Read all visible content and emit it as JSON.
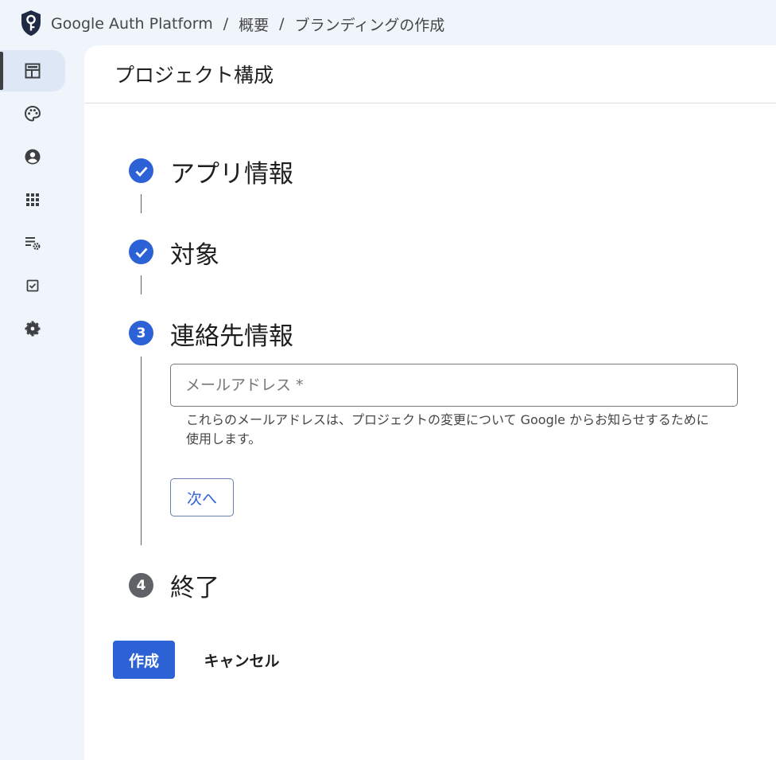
{
  "breadcrumb": {
    "app_name": "Google Auth Platform",
    "separator": "/",
    "items": [
      "概要",
      "ブランディングの作成"
    ]
  },
  "rail": {
    "items": [
      {
        "icon": "dashboard-icon",
        "active": true
      },
      {
        "icon": "palette-icon",
        "active": false
      },
      {
        "icon": "account-circle-icon",
        "active": false
      },
      {
        "icon": "apps-grid-icon",
        "active": false
      },
      {
        "icon": "list-settings-icon",
        "active": false
      },
      {
        "icon": "checkbox-icon",
        "active": false
      },
      {
        "icon": "gear-icon",
        "active": false
      }
    ]
  },
  "panel": {
    "title": "プロジェクト構成"
  },
  "steps": [
    {
      "title": "アプリ情報",
      "state": "done",
      "marker": ""
    },
    {
      "title": "対象",
      "state": "done",
      "marker": ""
    },
    {
      "title": "連絡先情報",
      "state": "current",
      "marker": "3"
    },
    {
      "title": "終了",
      "state": "todo",
      "marker": "4"
    }
  ],
  "contact": {
    "email_placeholder": "メールアドレス *",
    "email_value": "",
    "helper_text": "これらのメールアドレスは、プロジェクトの変更について Google からお知らせするために使用します。",
    "next_label": "次へ"
  },
  "actions": {
    "create_label": "作成",
    "cancel_label": "キャンセル"
  },
  "colors": {
    "accent": "#2d62d6",
    "rail_active": "#dde7f6",
    "background": "#f0f4fb"
  }
}
